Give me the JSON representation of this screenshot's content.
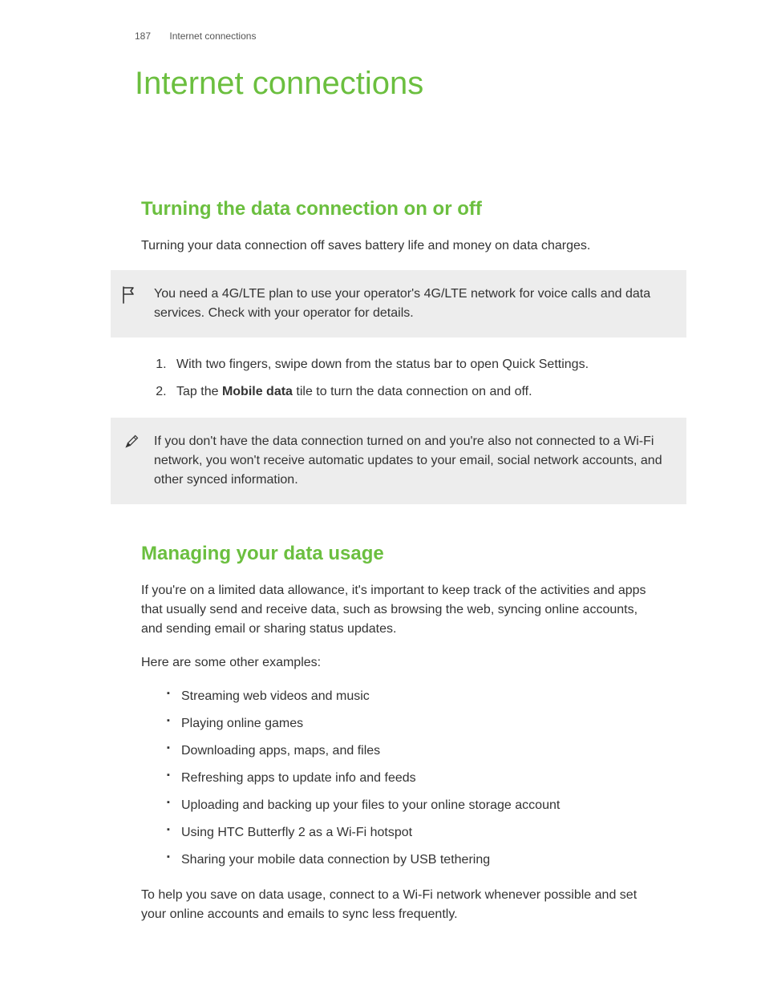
{
  "header": {
    "page_number": "187",
    "breadcrumb": "Internet connections"
  },
  "title": "Internet connections",
  "section1": {
    "heading": "Turning the data connection on or off",
    "intro": "Turning your data connection off saves battery life and money on data charges.",
    "callout_flag": "You need a 4G/LTE plan to use your operator's 4G/LTE network for voice calls and data services. Check with your operator for details.",
    "steps": {
      "s1": "With two fingers, swipe down from the status bar to open Quick Settings.",
      "s2_pre": "Tap the ",
      "s2_bold": "Mobile data",
      "s2_post": " tile to turn the data connection on and off."
    },
    "callout_pencil": "If you don't have the data connection turned on and you're also not connected to a Wi-Fi network, you won't receive automatic updates to your email, social network accounts, and other synced information."
  },
  "section2": {
    "heading": "Managing your data usage",
    "p1": "If you're on a limited data allowance, it's important to keep track of the activities and apps that usually send and receive data, such as browsing the web, syncing online accounts, and sending email or sharing status updates.",
    "p2": "Here are some other examples:",
    "bullets": {
      "b0": "Streaming web videos and music",
      "b1": "Playing online games",
      "b2": "Downloading apps, maps, and files",
      "b3": "Refreshing apps to update info and feeds",
      "b4": "Uploading and backing up your files to your online storage account",
      "b5": "Using HTC Butterfly 2 as a Wi-Fi hotspot",
      "b6": "Sharing your mobile data connection by USB tethering"
    },
    "p3": "To help you save on data usage, connect to a Wi-Fi network whenever possible and set your online accounts and emails to sync less frequently."
  }
}
